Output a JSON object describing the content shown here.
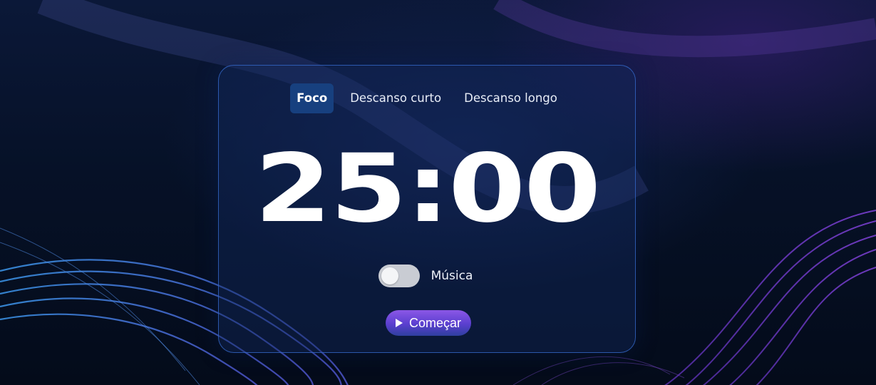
{
  "tabs": [
    {
      "label": "Foco",
      "active": true
    },
    {
      "label": "Descanso curto",
      "active": false
    },
    {
      "label": "Descanso longo",
      "active": false
    }
  ],
  "timer": {
    "display": "25:00"
  },
  "music": {
    "label": "Música",
    "enabled": false
  },
  "start_button": {
    "label": "Começar",
    "icon": "play-icon"
  },
  "colors": {
    "background": "#040d1f",
    "card_border": "#376ed2",
    "tab_active": "#17407f",
    "button_gradient_top": "#8b57e6",
    "button_gradient_bottom": "#2f3f9e",
    "toggle_off": "#c9ccd3"
  }
}
